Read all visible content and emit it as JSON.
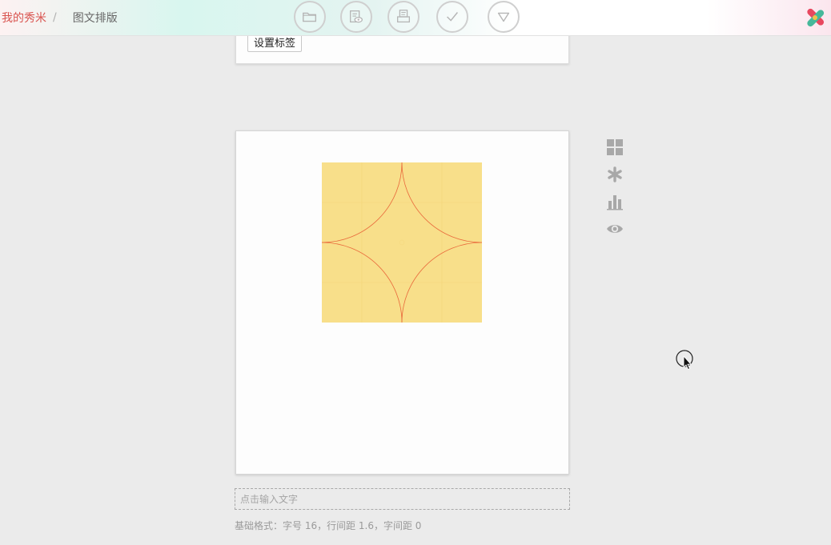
{
  "breadcrumb": {
    "home": "我的秀米",
    "separator": "/",
    "current": "图文排版"
  },
  "toolbar": {
    "tools": [
      {
        "icon": "folder-icon"
      },
      {
        "icon": "preview-icon"
      },
      {
        "icon": "print-icon"
      },
      {
        "icon": "checkmark-icon"
      },
      {
        "icon": "triangle-down-icon"
      }
    ]
  },
  "brand": {
    "icon": "xiumi-logo-icon"
  },
  "top_card": {
    "tag_button_label": "设置标签"
  },
  "editor": {
    "artwork": {
      "icon": "yellow-quarter-circle-pattern",
      "colors": {
        "fill": "#f8df8a",
        "line": "#e96a3c"
      }
    }
  },
  "side_tools": [
    {
      "icon": "grid-icon"
    },
    {
      "icon": "asterisk-icon"
    },
    {
      "icon": "bar-chart-icon"
    },
    {
      "icon": "eye-icon"
    }
  ],
  "text_input": {
    "placeholder": "点击输入文字",
    "value": ""
  },
  "format_info": "基础格式：字号 16，行间距 1.6，字间距 0",
  "colors": {
    "accent": "#d9534f",
    "icon_gray": "#a8a8a8",
    "background": "#ebebeb"
  }
}
